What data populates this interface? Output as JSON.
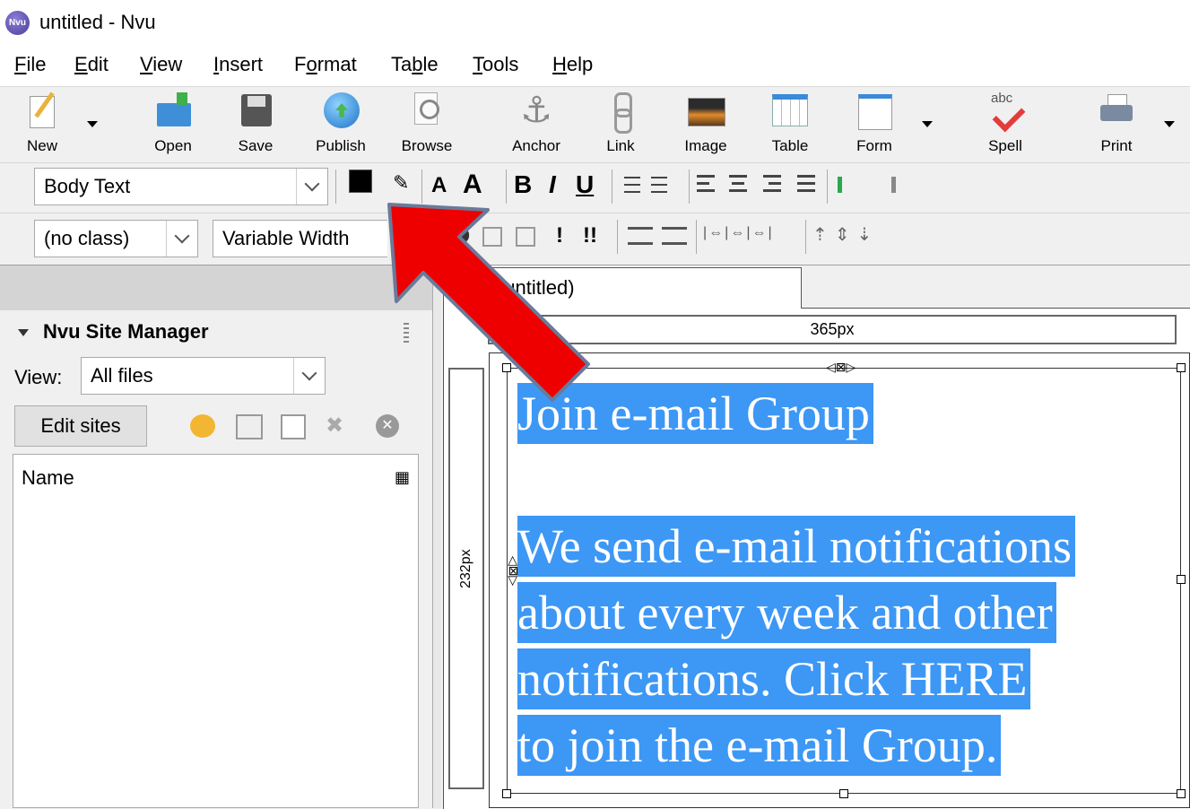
{
  "window": {
    "title": "untitled - Nvu",
    "logo_text": "Nvu"
  },
  "menu": [
    {
      "label": "File",
      "ul": "F"
    },
    {
      "label": "Edit",
      "ul": "E"
    },
    {
      "label": "View",
      "ul": "V"
    },
    {
      "label": "Insert",
      "ul": "I"
    },
    {
      "label": "Format",
      "ul": "o"
    },
    {
      "label": "Table",
      "ul": "b"
    },
    {
      "label": "Tools",
      "ul": "T"
    },
    {
      "label": "Help",
      "ul": "H"
    }
  ],
  "toolbar": {
    "new": "New",
    "open": "Open",
    "save": "Save",
    "publish": "Publish",
    "browse": "Browse",
    "anchor": "Anchor",
    "link": "Link",
    "image": "Image",
    "table": "Table",
    "form": "Form",
    "spell": "Spell",
    "print": "Print"
  },
  "format": {
    "paragraph_style": "Body Text",
    "class": "(no class)",
    "font": "Variable Width",
    "text_color": "#000000",
    "bold": "B",
    "italic": "I",
    "underline": "U",
    "bullet_list": "!",
    "numbered_list": "!!"
  },
  "site_manager": {
    "panel_close": "×",
    "title": "Nvu Site Manager",
    "view_label": "View:",
    "view_value": "All files",
    "edit_sites": "Edit sites",
    "column_name": "Name"
  },
  "editor": {
    "tab_label": "(untitled)",
    "width_label": "365px",
    "height_label": "232px",
    "content_lines": [
      "Join e-mail Group",
      "We send e-mail notifications",
      "about every week and other",
      "notifications.  Click HERE",
      "to join the e-mail Group."
    ],
    "selection_color": "#3d97f5"
  },
  "annotation": {
    "arrow_color": "#ee0000"
  }
}
